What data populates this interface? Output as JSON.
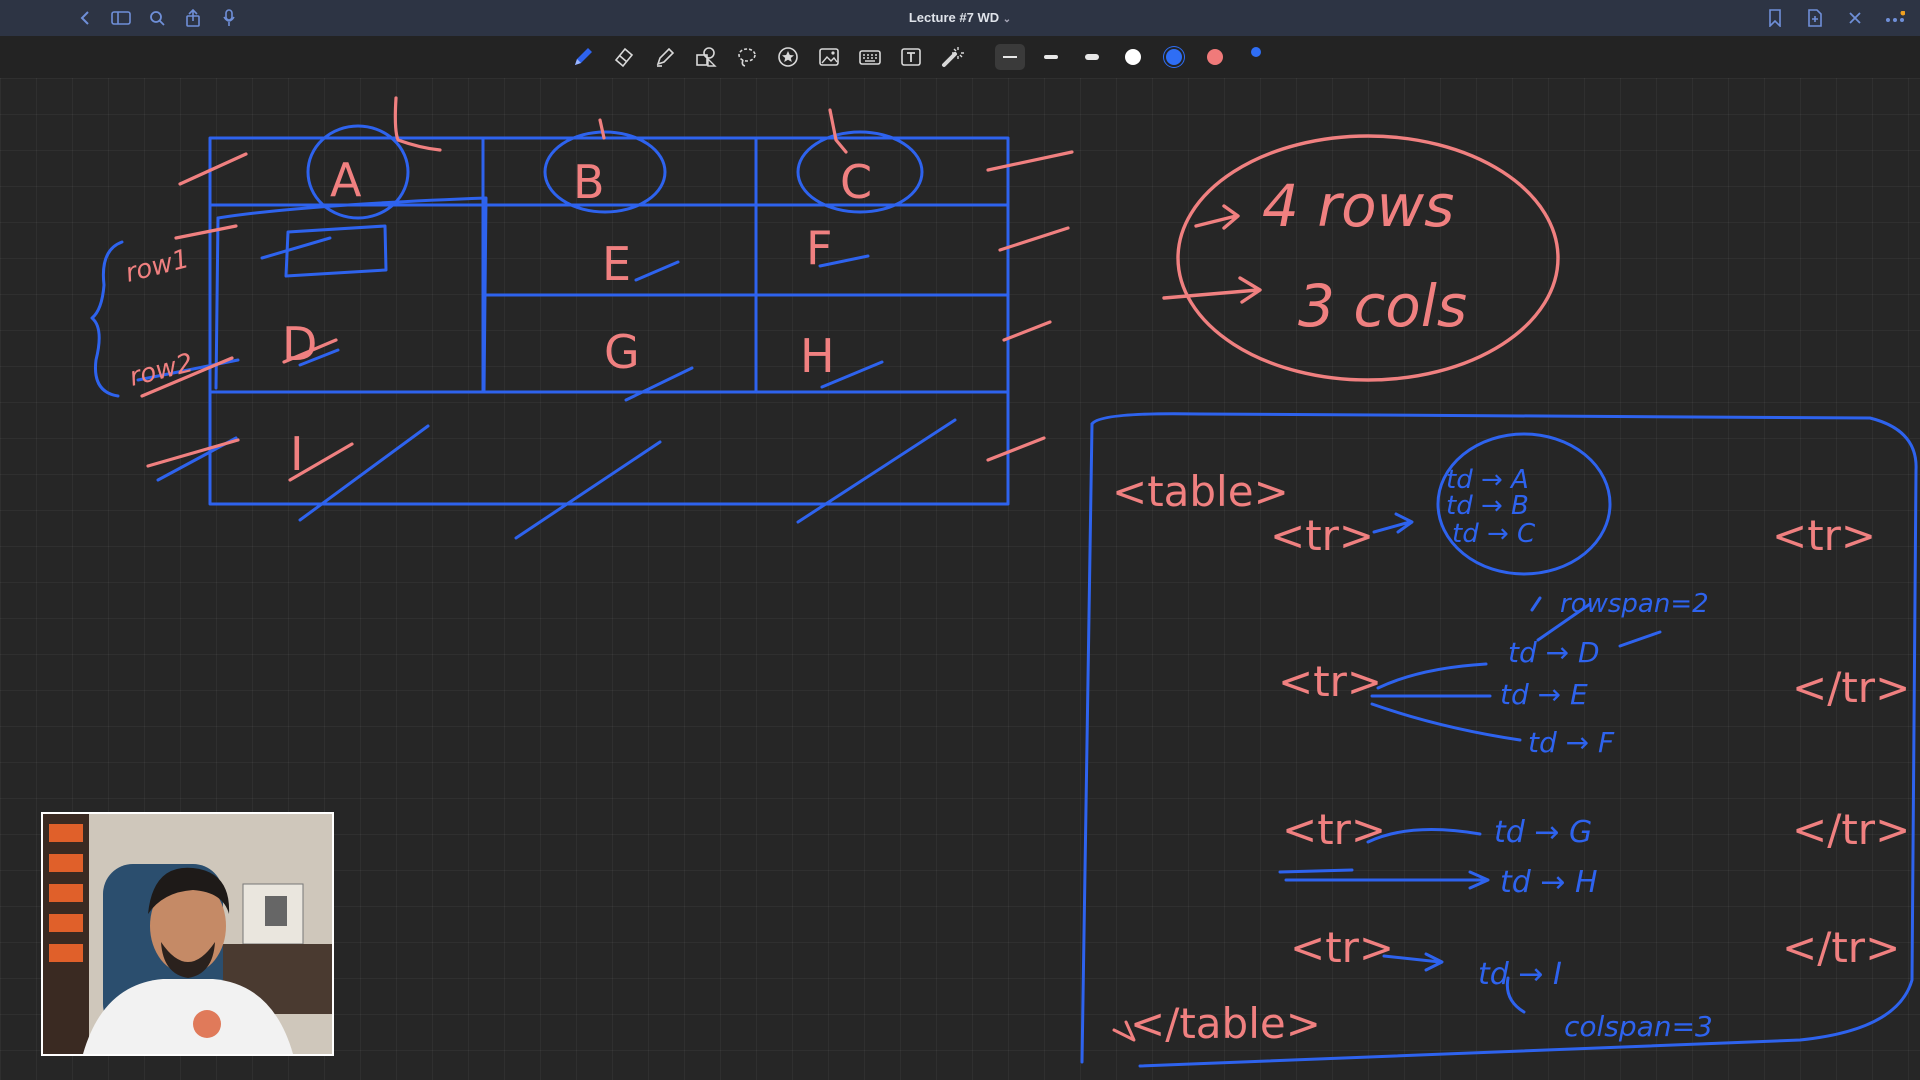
{
  "window": {
    "title": "Lecture #7 WD",
    "title_chevron": "⌄"
  },
  "titlebar_icons_left": [
    "back-icon",
    "sidebar-icon",
    "search-icon",
    "share-icon",
    "microphone-icon"
  ],
  "titlebar_icons_right": [
    "bookmark-icon",
    "add-page-icon",
    "close-icon",
    "more-icon"
  ],
  "toolbar": {
    "tools": [
      "pen-tool",
      "eraser-tool",
      "highlighter-tool",
      "shapes-tool",
      "lasso-tool",
      "sticker-tool",
      "image-tool",
      "keyboard-tool",
      "text-tool",
      "laser-tool"
    ],
    "stroke_widths": [
      "thin",
      "medium",
      "thick"
    ],
    "colors": [
      "#ffffff",
      "#2f6ef5",
      "#f07a7a",
      "#2f6ef5"
    ],
    "selected_color": "#2f6ef5"
  },
  "ink_colors": {
    "blue": "#2e63ee",
    "red": "#f08080"
  },
  "whiteboard": {
    "table_headers": [
      "A",
      "B",
      "C"
    ],
    "table_cells": [
      "D",
      "E",
      "F",
      "G",
      "H",
      "I"
    ],
    "row_notes": [
      "row1",
      "row2"
    ],
    "summary_rows": "4 rows",
    "summary_cols": "3 cols",
    "code": {
      "table_open": "<table>",
      "table_close": "</table>",
      "tr_open": "<tr>",
      "tr_close": "</tr>",
      "row1_cells": [
        "td → A",
        "td → B",
        "td → C"
      ],
      "row2_note": "rowspan=2",
      "row2_cells": [
        "td → D",
        "td → E",
        "td → F"
      ],
      "row3_cells": [
        "td → G",
        "td → H"
      ],
      "row4_cell": "td → I",
      "row4_note": "colspan=3"
    }
  }
}
